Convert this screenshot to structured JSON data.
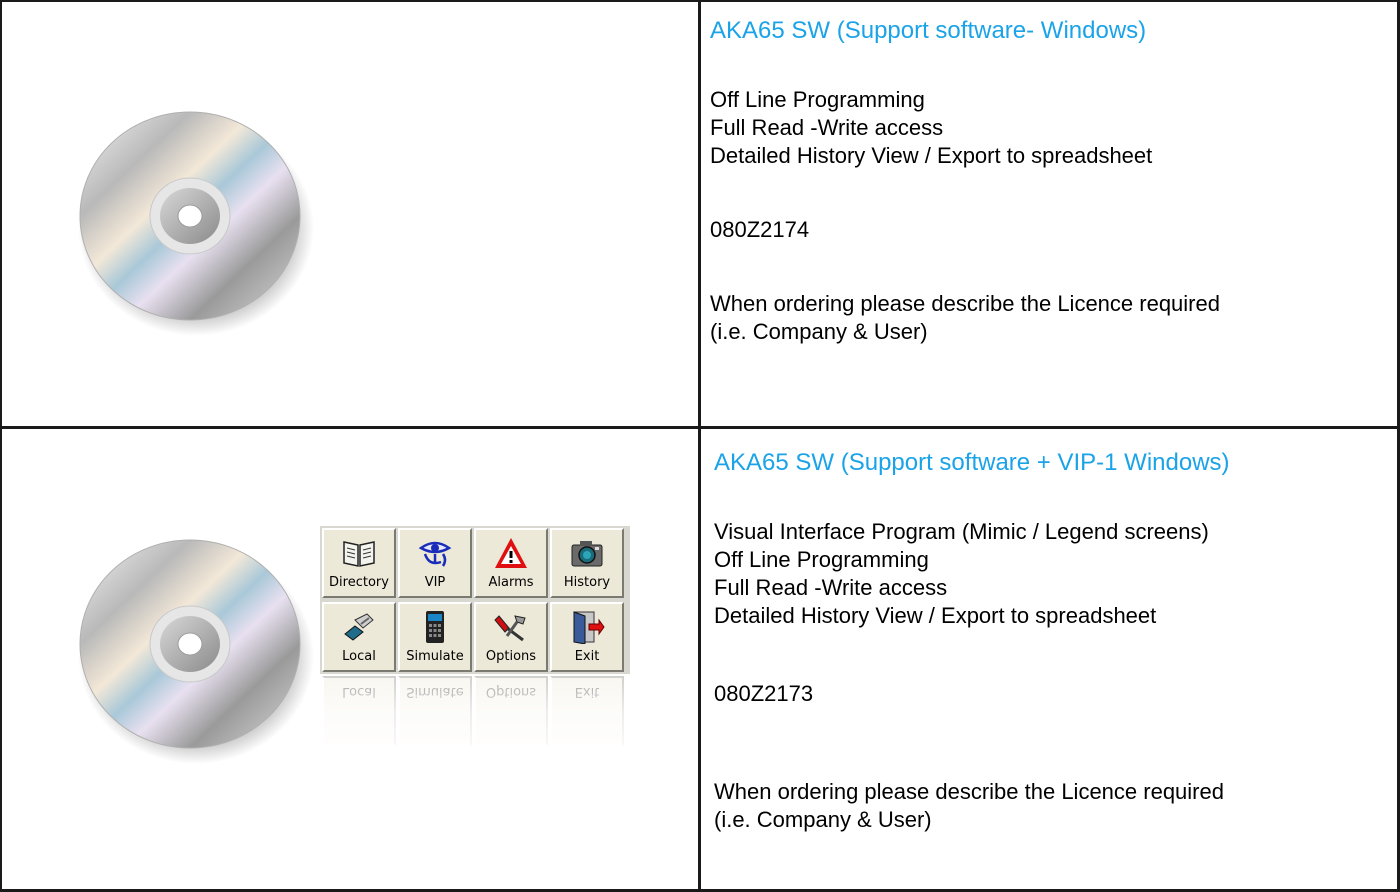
{
  "rows": [
    {
      "title": "AKA65 SW (Support software- Windows)",
      "features": [
        "Off Line Programming",
        "Full Read -Write access",
        "Detailed History View / Export to spreadsheet"
      ],
      "part_number": "080Z2174",
      "order_note_line1": "When ordering please describe the Licence required",
      "order_note_line2": "(i.e. Company & User)"
    },
    {
      "title": "AKA65 SW (Support software + VIP-1 Windows)",
      "features": [
        "Visual Interface Program (Mimic / Legend screens)",
        "Off Line Programming",
        "Full Read -Write access",
        "Detailed History View / Export to spreadsheet"
      ],
      "part_number": "080Z2173",
      "order_note_line1": "When ordering please describe the Licence required",
      "order_note_line2": "(i.e. Company & User)"
    }
  ],
  "toolbar": {
    "buttons": [
      {
        "label": "Directory",
        "icon": "book-icon"
      },
      {
        "label": "VIP",
        "icon": "eye-icon"
      },
      {
        "label": "Alarms",
        "icon": "warning-icon"
      },
      {
        "label": "History",
        "icon": "camera-icon"
      },
      {
        "label": "Local",
        "icon": "phone-icon"
      },
      {
        "label": "Simulate",
        "icon": "keypad-icon"
      },
      {
        "label": "Options",
        "icon": "tools-icon"
      },
      {
        "label": "Exit",
        "icon": "exit-door-icon"
      }
    ]
  },
  "colors": {
    "title_blue": "#1aa3e8",
    "border": "#1a1a1a",
    "button_face": "#ece9d8",
    "alarm_red": "#e01010"
  }
}
